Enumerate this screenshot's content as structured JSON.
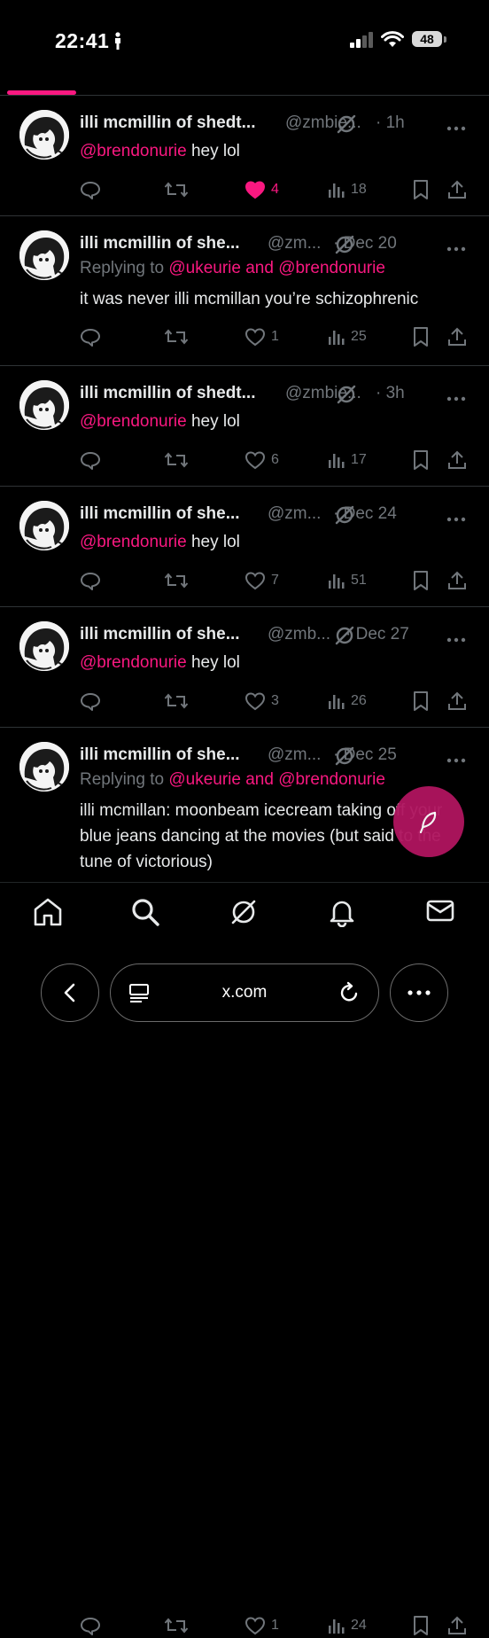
{
  "status_bar": {
    "time": "22:41",
    "battery": "48"
  },
  "colors": {
    "accent": "#f91880",
    "background": "#000000",
    "text": "#e7e9ea",
    "muted": "#71767b",
    "divider": "#2f3336"
  },
  "tweets": [
    {
      "name": "illi mcmillin of shedt...",
      "handle": "@zmbie...",
      "time": "· 1h",
      "reply_prefix": "",
      "reply_users": "",
      "mention": "@brendonurie",
      "text": " hey lol",
      "replies": "",
      "retweets": "",
      "likes": "4",
      "liked": true,
      "views": "18"
    },
    {
      "name": "illi mcmillin of she...",
      "handle": "@zm...",
      "time": "· Dec 20",
      "reply_prefix": "Replying to ",
      "reply_users": "@ukeurie and @brendonurie",
      "mention": "",
      "text": "it was never illi mcmillan you’re schizophrenic",
      "replies": "",
      "retweets": "",
      "likes": "1",
      "liked": false,
      "views": "25"
    },
    {
      "name": "illi mcmillin of shedt...",
      "handle": "@zmbie...",
      "time": "· 3h",
      "reply_prefix": "",
      "reply_users": "",
      "mention": "@brendonurie",
      "text": " hey lol",
      "replies": "",
      "retweets": "",
      "likes": "6",
      "liked": false,
      "views": "17"
    },
    {
      "name": "illi mcmillin of she...",
      "handle": "@zm...",
      "time": "· Dec 24",
      "reply_prefix": "",
      "reply_users": "",
      "mention": "@brendonurie",
      "text": " hey lol",
      "replies": "",
      "retweets": "",
      "likes": "7",
      "liked": false,
      "views": "51"
    },
    {
      "name": "illi mcmillin of she...",
      "handle": "@zmb...",
      "time": "· Dec 27",
      "reply_prefix": "",
      "reply_users": "",
      "mention": "@brendonurie",
      "text": " hey lol",
      "replies": "",
      "retweets": "",
      "likes": "3",
      "liked": false,
      "views": "26"
    },
    {
      "name": "illi mcmillin of she...",
      "handle": "@zm...",
      "time": "· Dec 25",
      "reply_prefix": "Replying to ",
      "reply_users": "@ukeurie and @brendonurie",
      "mention": "",
      "text": "illi mcmillan: moonbeam icecream taking off your blue jeans dancing at the movies (but said to the tune of victorious)",
      "replies": "",
      "retweets": "",
      "likes": "1",
      "liked": false,
      "views": "24"
    }
  ],
  "bottom_nav": {
    "items": [
      "home-icon",
      "search-icon",
      "grok-icon",
      "notifications-icon",
      "messages-icon"
    ]
  },
  "browser": {
    "url": "x.com"
  }
}
